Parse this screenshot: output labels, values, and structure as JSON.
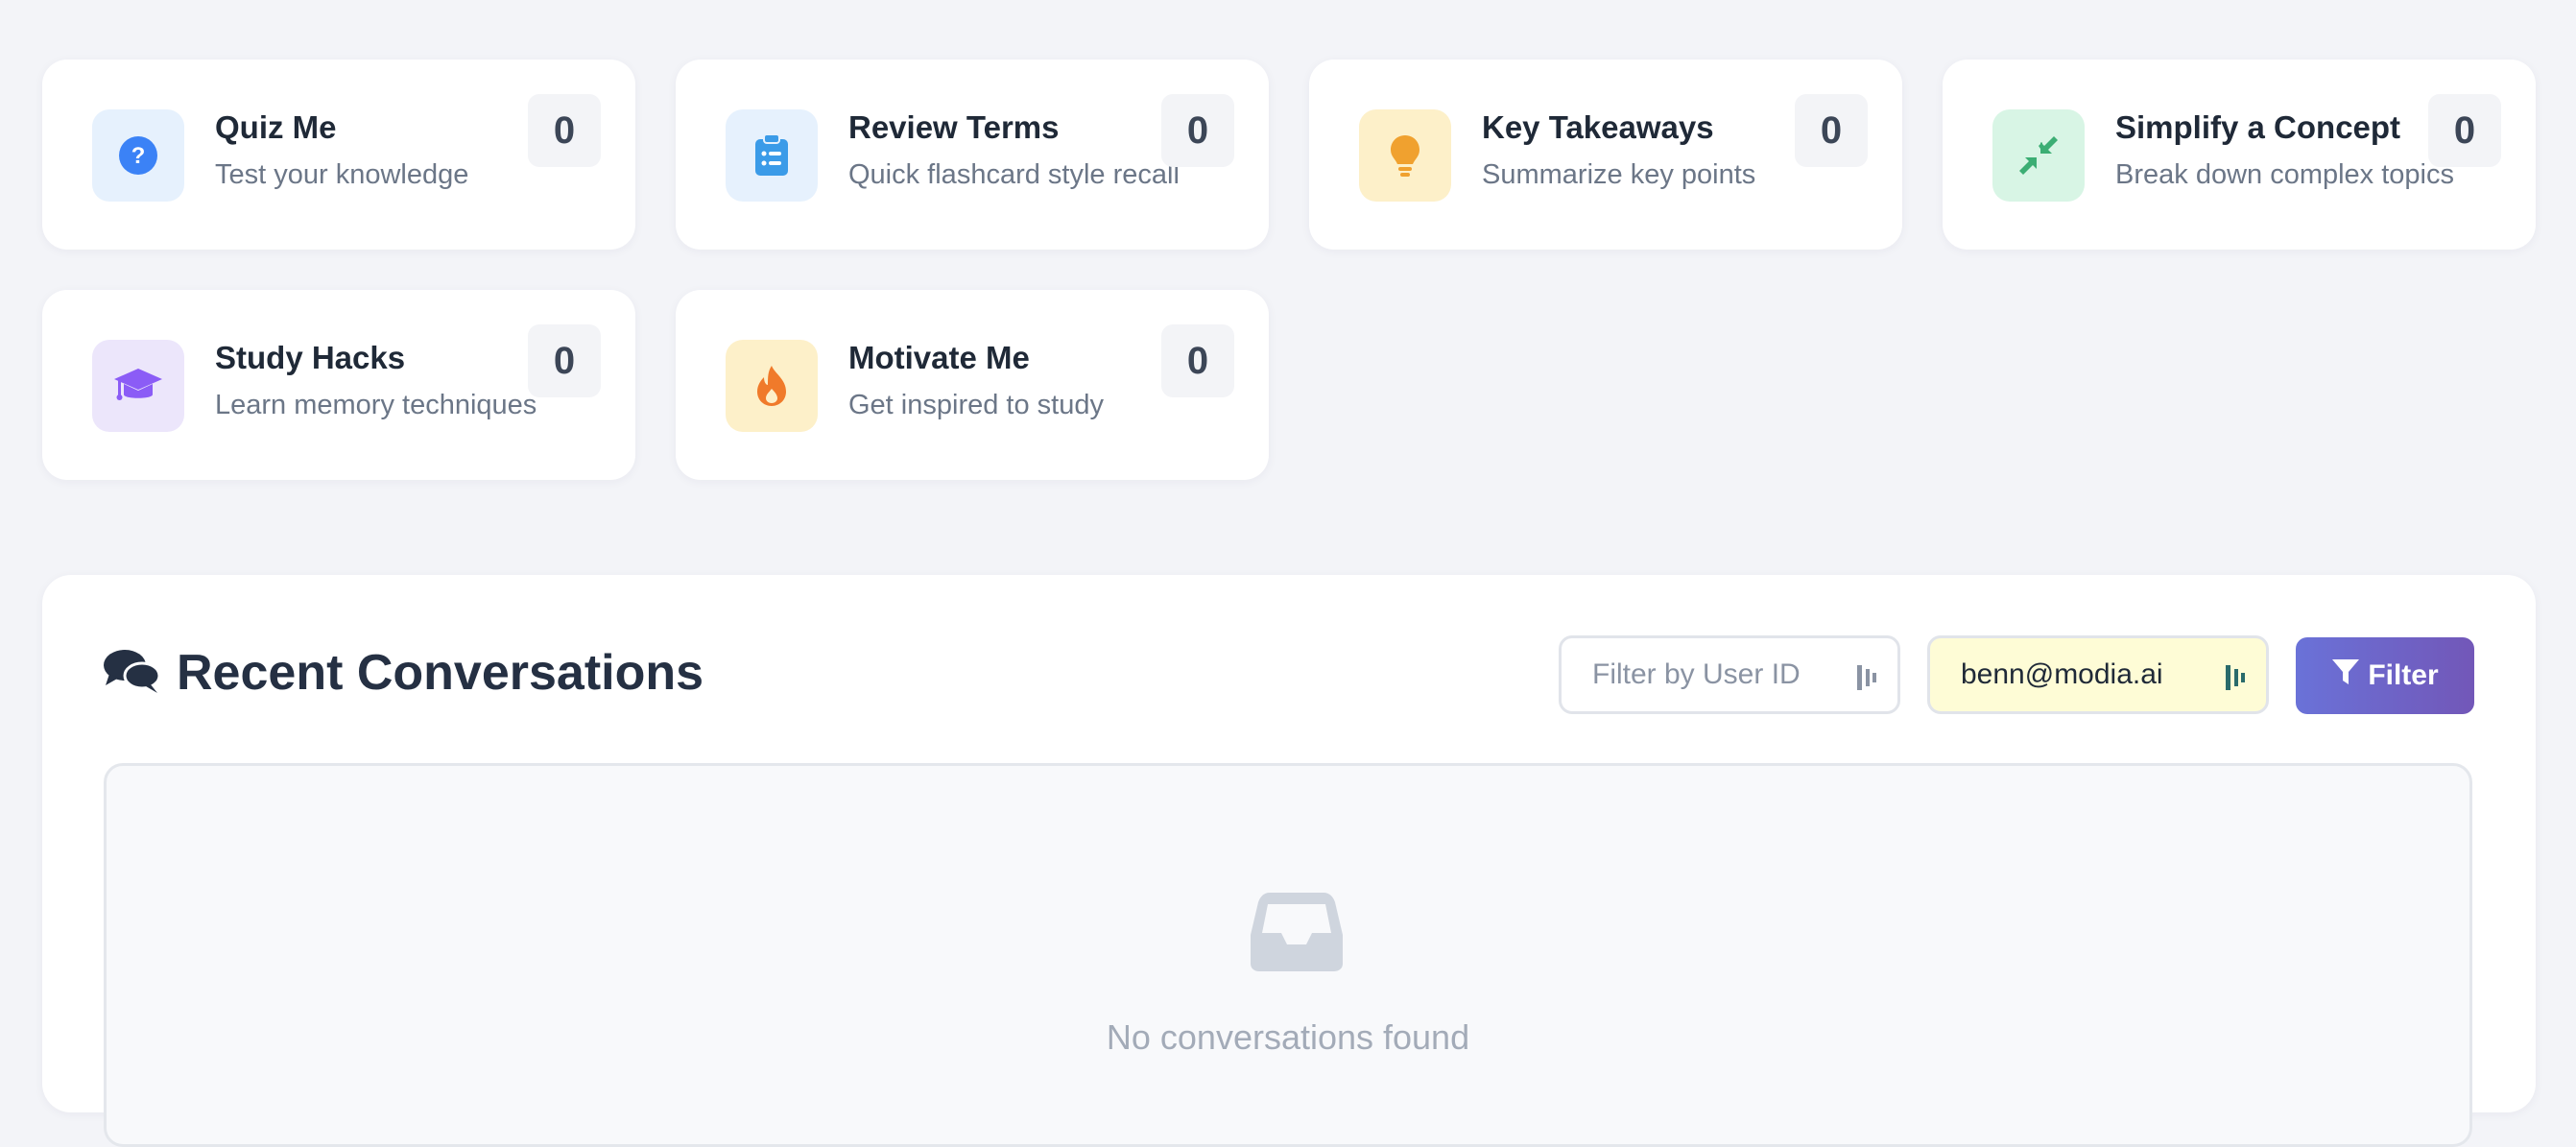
{
  "cards": [
    {
      "title": "Quiz Me",
      "subtitle": "Test your knowledge",
      "count": "0",
      "icon": "question-circle-icon",
      "icon_bg": "#e6f1fd",
      "icon_color": "#3b82f6"
    },
    {
      "title": "Review Terms",
      "subtitle": "Quick flashcard style recall",
      "count": "0",
      "icon": "clipboard-list-icon",
      "icon_bg": "#e6f1fd",
      "icon_color": "#3b9be8"
    },
    {
      "title": "Key Takeaways",
      "subtitle": "Summarize key points",
      "count": "0",
      "icon": "lightbulb-icon",
      "icon_bg": "#fdf0c9",
      "icon_color": "#f0a12f"
    },
    {
      "title": "Simplify a Concept",
      "subtitle": "Break down complex topics",
      "count": "0",
      "icon": "compress-arrows-icon",
      "icon_bg": "#d8f5e5",
      "icon_color": "#3cae74"
    },
    {
      "title": "Study Hacks",
      "subtitle": "Learn memory techniques",
      "count": "0",
      "icon": "graduation-cap-icon",
      "icon_bg": "#ece6fb",
      "icon_color": "#8b5cf6"
    },
    {
      "title": "Motivate Me",
      "subtitle": "Get inspired to study",
      "count": "0",
      "icon": "fire-icon",
      "icon_bg": "#fdf0c9",
      "icon_color": "#f07a2a"
    }
  ],
  "conversations": {
    "title": "Recent Conversations",
    "filter_placeholder": "Filter by User ID",
    "filter_value": "",
    "email_value": "benn@modia.ai",
    "filter_button": "Filter",
    "empty_message": "No conversations found"
  },
  "colors": {
    "accent_start": "#6a72d8",
    "accent_end": "#7257b8",
    "email_field_bg": "#fefcd6"
  }
}
